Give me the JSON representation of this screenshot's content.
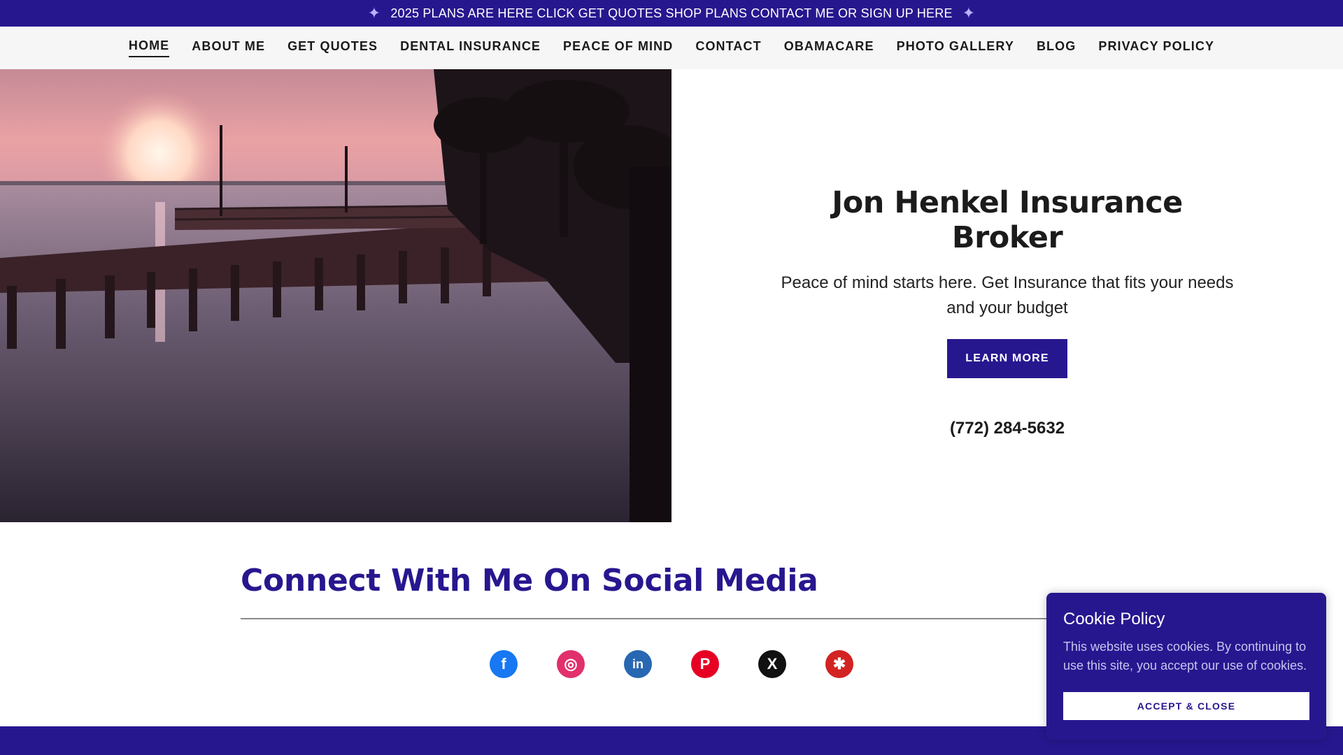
{
  "announcement": {
    "text": "2025 PLANS ARE HERE CLICK GET QUOTES SHOP PLANS CONTACT ME OR SIGN UP HERE",
    "icon": "sparkle-icon"
  },
  "nav": {
    "items": [
      {
        "label": "HOME",
        "active": true
      },
      {
        "label": "ABOUT ME"
      },
      {
        "label": "GET QUOTES"
      },
      {
        "label": "DENTAL INSURANCE"
      },
      {
        "label": "PEACE OF MIND"
      },
      {
        "label": "CONTACT"
      },
      {
        "label": "OBAMACARE"
      },
      {
        "label": "PHOTO GALLERY"
      },
      {
        "label": "BLOG"
      },
      {
        "label": "PRIVACY POLICY"
      }
    ]
  },
  "hero": {
    "title": "Jon Henkel Insurance Broker",
    "subtitle": "Peace of mind starts here. Get Insurance that fits your needs and your budget",
    "button_label": "LEARN MORE",
    "phone": "(772) 284-5632"
  },
  "social": {
    "heading": "Connect With Me On Social Media",
    "icons": [
      {
        "name": "facebook-icon",
        "glyph": "f",
        "color": "#1877f2"
      },
      {
        "name": "instagram-icon",
        "glyph": "◎",
        "color": "#e1306c"
      },
      {
        "name": "linkedin-icon",
        "glyph": "in",
        "color": "#2867b2"
      },
      {
        "name": "pinterest-icon",
        "glyph": "P",
        "color": "#e60023"
      },
      {
        "name": "x-icon",
        "glyph": "X",
        "color": "#111111"
      },
      {
        "name": "yelp-icon",
        "glyph": "✱",
        "color": "#d32323"
      }
    ]
  },
  "cookie": {
    "title": "Cookie Policy",
    "text": "This website uses cookies. By continuing to use this site, you accept our use of cookies.",
    "button_label": "ACCEPT & CLOSE"
  },
  "colors": {
    "brand": "#27178f"
  }
}
